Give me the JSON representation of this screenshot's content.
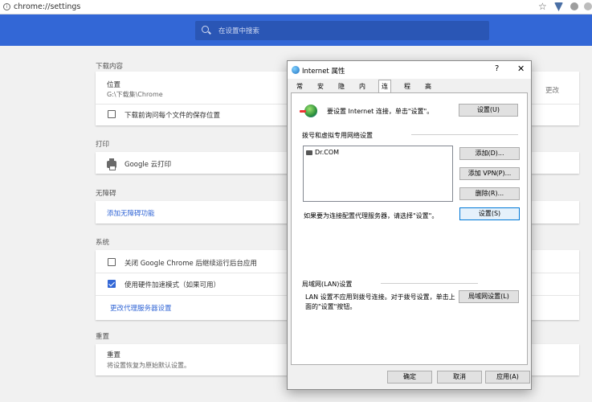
{
  "browser": {
    "url": "chrome://settings",
    "search_placeholder": "在设置中搜索"
  },
  "settings": {
    "downloads": {
      "section": "下载内容",
      "location_label": "位置",
      "location_value": "G:\\下载集\\Chrome",
      "change_label": "更改",
      "ask_label": "下载前询问每个文件的保存位置"
    },
    "printing": {
      "section": "打印",
      "cloud_print": "Google 云打印"
    },
    "accessibility": {
      "section": "无障碍",
      "add_features": "添加无障碍功能"
    },
    "system": {
      "section": "系统",
      "continue_background": "关闭 Google Chrome 后继续运行后台应用",
      "hardware_accel": "使用硬件加速模式（如果可用）",
      "proxy_link": "更改代理服务器设置"
    },
    "reset": {
      "section": "重置",
      "title": "重置",
      "desc": "将设置恢复为原始默认设置。"
    }
  },
  "dialog": {
    "title": "Internet 属性",
    "help": "?",
    "close": "✕",
    "tabs": [
      "常规",
      "安全",
      "隐私",
      "内容",
      "连接",
      "程序",
      "高级"
    ],
    "active_tab": "连接",
    "setup_text": "要设置 Internet 连接，单击\"设置\"。",
    "setup_button": "设置(U)",
    "dialup_group": "拨号和虚拟专用网络设置",
    "connections": [
      "Dr.COM"
    ],
    "add_button": "添加(D)...",
    "add_vpn_button": "添加 VPN(P)...",
    "remove_button": "删除(R)...",
    "proxy_text": "如果要为连接配置代理服务器，请选择\"设置\"。",
    "settings_button": "设置(S)",
    "lan_group": "局域网(LAN)设置",
    "lan_text_1": "LAN 设置不应用到拨号连接。对于拨号设置，单击上",
    "lan_text_2": "面的\"设置\"按钮。",
    "lan_button": "局域网设置(L)",
    "ok_button": "确定",
    "cancel_button": "取消",
    "apply_button": "应用(A)"
  }
}
